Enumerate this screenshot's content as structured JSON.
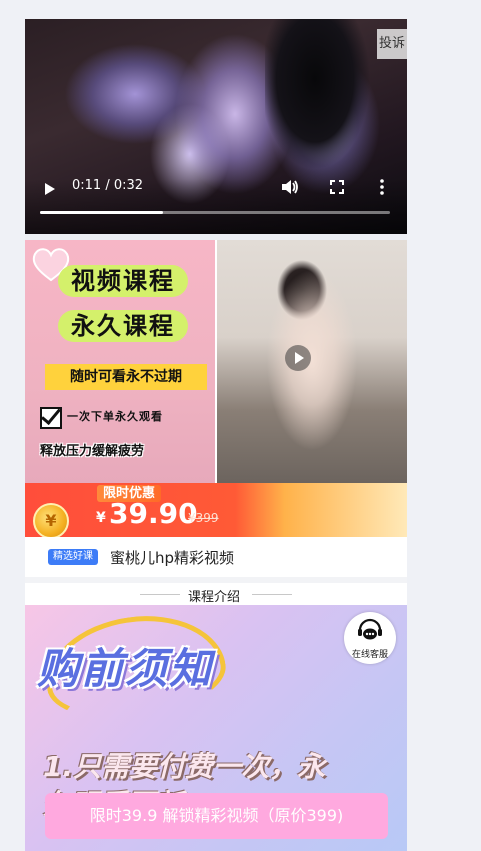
{
  "video": {
    "report_label": "投诉",
    "time": "0:11 / 0:32",
    "progress_fraction": 0.35
  },
  "banner": {
    "pill1": "视频课程",
    "pill2": "永久课程",
    "strip": "随时可看永不过期",
    "check_text": "一次下单永久观看",
    "relax_text": "释放压力缓解疲劳"
  },
  "promo": {
    "tag": "限时优惠",
    "currency": "¥",
    "price": "39.90",
    "original_price": "¥399",
    "coin_symbol": "¥"
  },
  "course": {
    "badge": "精选好课",
    "title": "蜜桃儿hp精彩视频"
  },
  "section": {
    "title": "课程介绍"
  },
  "notice": {
    "heading": "购前须知",
    "line1": "1.只需要付费一次，永",
    "line2": "久观看更新"
  },
  "service": {
    "label": "在线客服"
  },
  "cta": {
    "label": "限时39.9 解锁精彩视频（原价399)"
  },
  "colors": {
    "accent_blue": "#3d7cf7",
    "promo_red": "#ff4e3b",
    "pill_green": "#d4f06b",
    "cta_pink": "#ffa9df"
  }
}
